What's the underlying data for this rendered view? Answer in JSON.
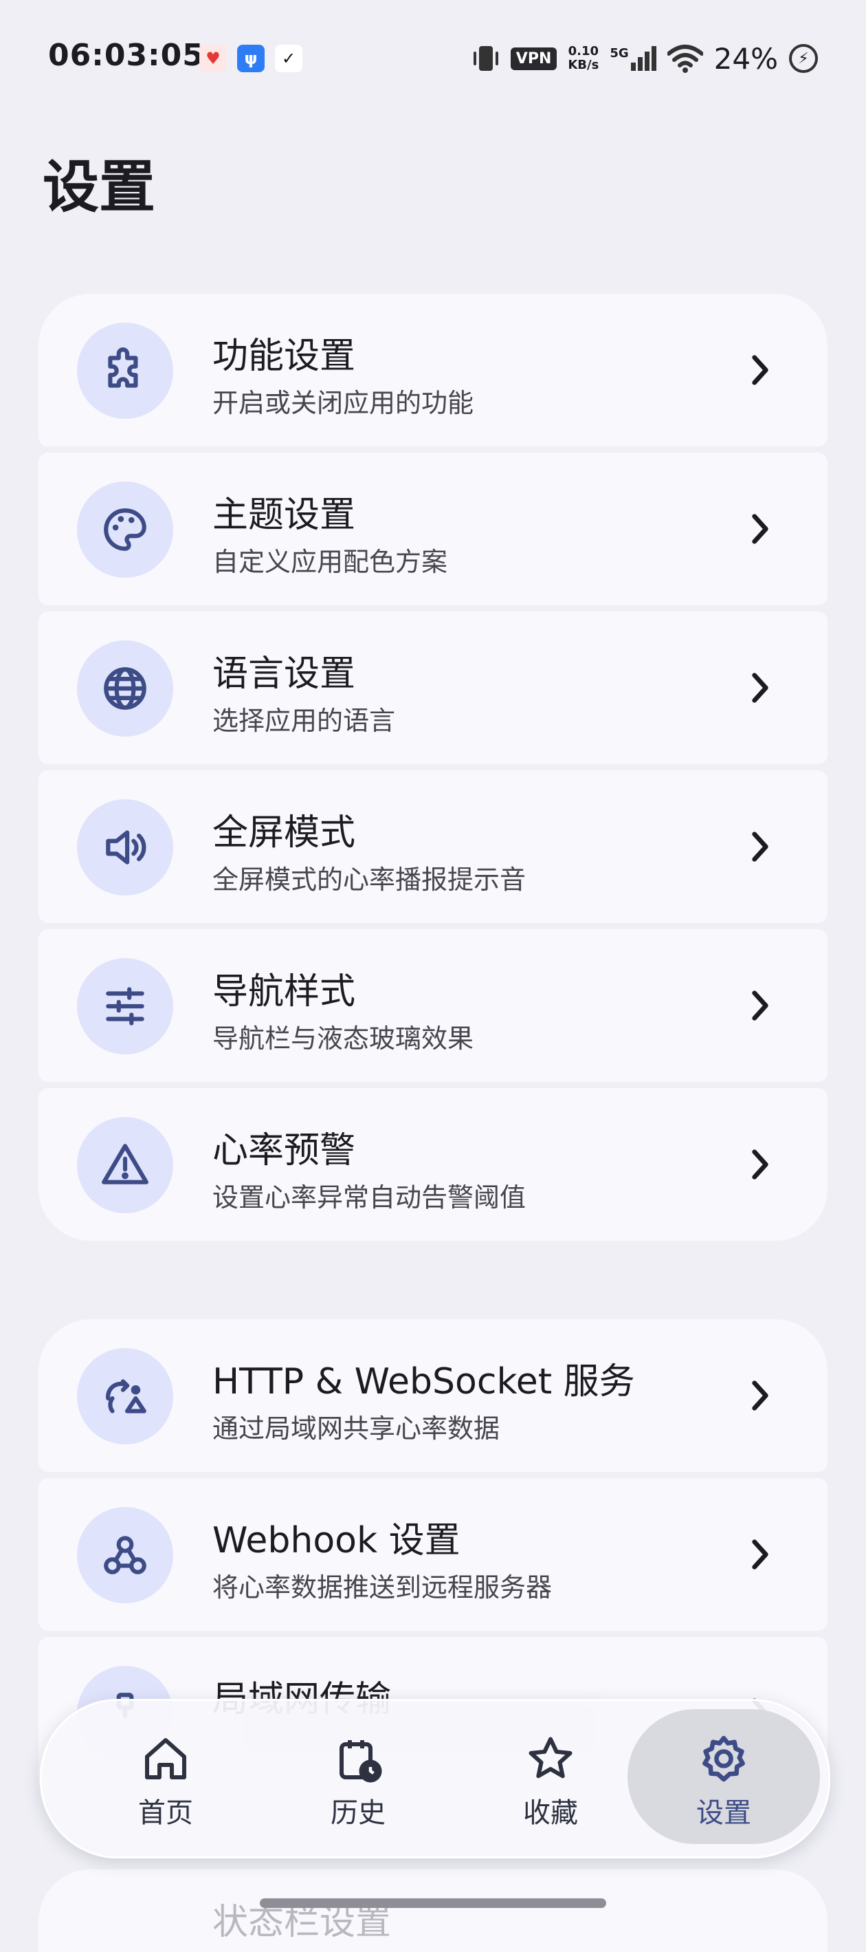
{
  "status_bar": {
    "time": "06:03:05",
    "app_icons": [
      "heart-app-icon",
      "usb-icon",
      "check-app-icon"
    ],
    "vpn": "VPN",
    "net_speed_value": "0.10",
    "net_speed_unit": "KB/s",
    "network": "5G",
    "battery": "24%"
  },
  "page_title": "设置",
  "groups": [
    {
      "items": [
        {
          "icon": "puzzle-icon",
          "title": "功能设置",
          "subtitle": "开启或关闭应用的功能"
        },
        {
          "icon": "palette-icon",
          "title": "主题设置",
          "subtitle": "自定义应用配色方案"
        },
        {
          "icon": "globe-icon",
          "title": "语言设置",
          "subtitle": "选择应用的语言"
        },
        {
          "icon": "volume-icon",
          "title": "全屏模式",
          "subtitle": "全屏模式的心率播报提示音"
        },
        {
          "icon": "sliders-icon",
          "title": "导航样式",
          "subtitle": "导航栏与液态玻璃效果"
        },
        {
          "icon": "warning-icon",
          "title": "心率预警",
          "subtitle": "设置心率异常自动告警阈值"
        }
      ]
    },
    {
      "items": [
        {
          "icon": "broadcast-icon",
          "title": "HTTP & WebSocket 服务",
          "subtitle": "通过局域网共享心率数据"
        },
        {
          "icon": "webhook-icon",
          "title": "Webhook 设置",
          "subtitle": "将心率数据推送到远程服务器"
        },
        {
          "icon": "lan-icon",
          "title": "局域网传输",
          "subtitle": ""
        }
      ]
    }
  ],
  "peek_item_title": "状态栏设置",
  "bottom_nav": {
    "items": [
      {
        "icon": "home-icon",
        "label": "首页",
        "active": false
      },
      {
        "icon": "history-icon",
        "label": "历史",
        "active": false
      },
      {
        "icon": "star-icon",
        "label": "收藏",
        "active": false
      },
      {
        "icon": "settings-gear-icon",
        "label": "设置",
        "active": true
      }
    ]
  },
  "colors": {
    "background": "#EFEFF5",
    "card": "#F9F8FC",
    "icon_circle": "#DFE3FB",
    "icon": "#3D4C86",
    "active_nav": "#3D4C86"
  }
}
